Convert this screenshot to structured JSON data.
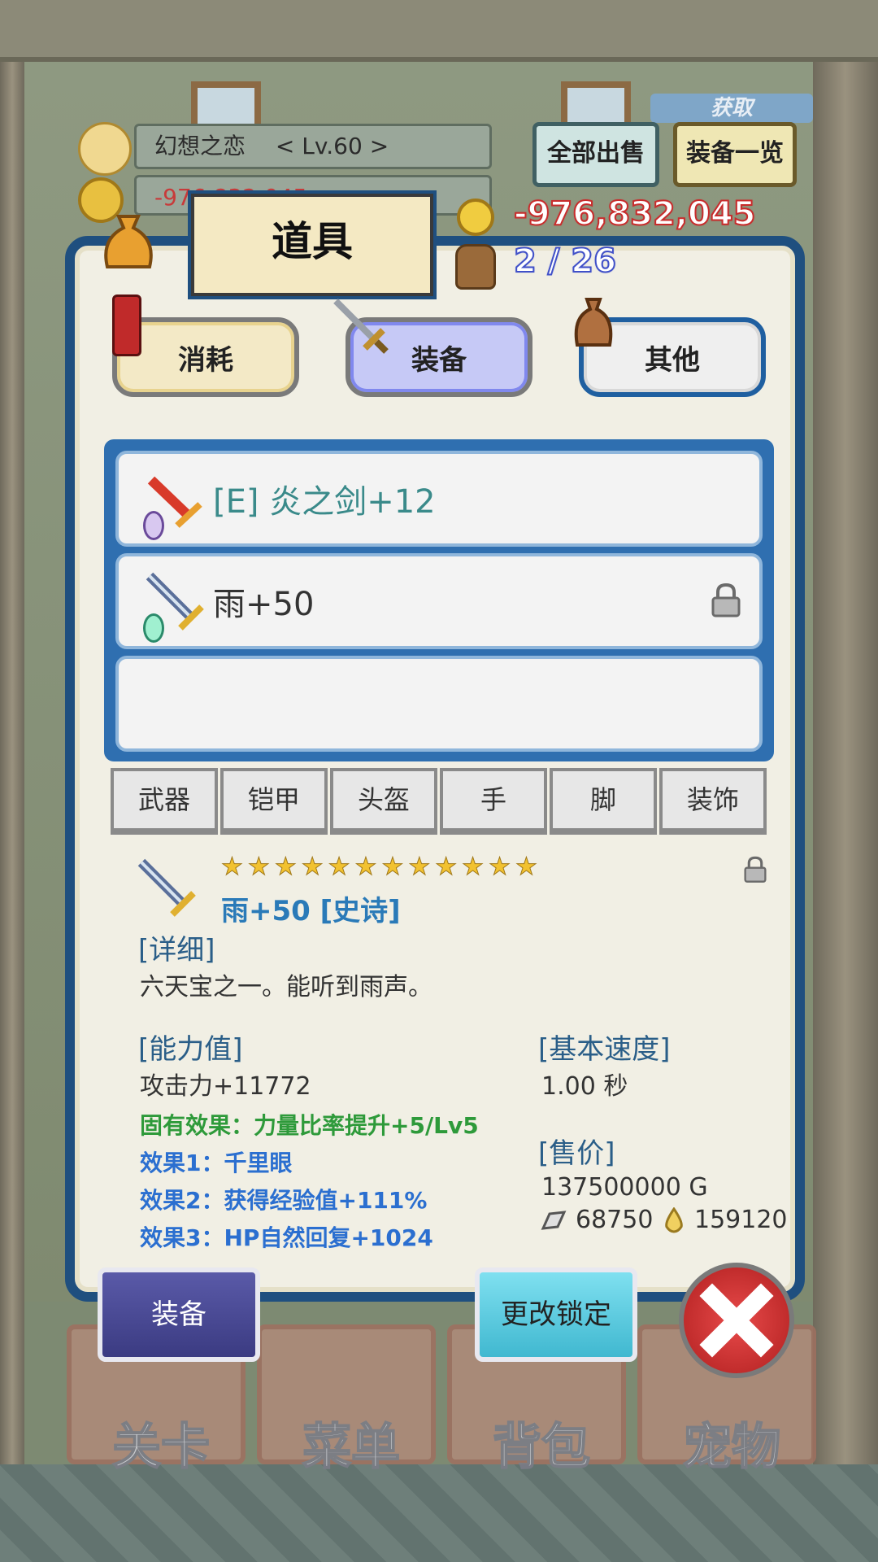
{
  "header": {
    "player_name": "幻想之恋",
    "player_level": "< Lv.60 >",
    "money_box_text": "-976,832,045",
    "sell_all_label": "全部出售",
    "equip_list_label": "装备一览",
    "banner_text": "获取"
  },
  "panel": {
    "title": "道具",
    "gold": "-976,832,045",
    "bag_count": "2 / 26",
    "categories": [
      "消耗",
      "装备",
      "其他"
    ],
    "active_category": "装备"
  },
  "item_list": [
    {
      "name": "[E] 炎之剑+12",
      "color": "#3a8a8a",
      "locked": false
    },
    {
      "name": "雨+50",
      "color": "#333333",
      "locked": true
    },
    {
      "name": "",
      "locked": false
    }
  ],
  "slot_tabs": [
    "武器",
    "铠甲",
    "头盔",
    "手",
    "脚",
    "装饰"
  ],
  "detail": {
    "stars": 12,
    "item_title": "雨+50 [史诗]",
    "detail_heading": "[详细]",
    "description": "六天宝之一。能听到雨声。",
    "stats_heading": "[能力值]",
    "attack": "攻击力+11772",
    "inherent": "固有效果：力量比率提升+5/Lv5",
    "effect1": "效果1：千里眼",
    "effect2": "效果2：获得经验值+111%",
    "effect3": "效果3：HP自然回复+1024",
    "speed_heading": "[基本速度]",
    "speed_value": "1.00 秒",
    "price_heading": "[售价]",
    "price_value": "137500000 G",
    "ore_value": "68750",
    "drop_value": "159120"
  },
  "actions": {
    "equip_label": "装备",
    "change_lock_label": "更改锁定"
  },
  "nav": [
    "关卡",
    "菜单",
    "背包",
    "宠物"
  ],
  "colors": {
    "panel_border": "#1f4f7f",
    "gold_text": "#c82c2c",
    "bag_text": "#4050c8",
    "green_effect": "#2e9a3a",
    "blue_effect": "#2b6fd0"
  }
}
